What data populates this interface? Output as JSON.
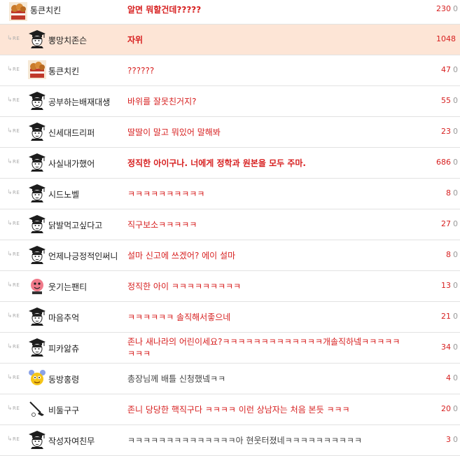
{
  "rows": [
    {
      "reply": false,
      "avatar": "fried-chicken-avatar",
      "nickname": "통큰치킨",
      "comment": "알면 뭐할건데?????",
      "style": "bold",
      "score": "230",
      "zero": "0"
    },
    {
      "reply": true,
      "avatar": "graduate-cap-avatar",
      "nickname": "뽕망치존슨",
      "comment": "자위",
      "style": "bold",
      "score": "1048",
      "zero": "",
      "highlight": true
    },
    {
      "reply": true,
      "avatar": "fried-chicken-avatar",
      "nickname": "통큰치킨",
      "comment": "??????",
      "style": "normal",
      "score": "47",
      "zero": "0"
    },
    {
      "reply": true,
      "avatar": "graduate-cap-avatar",
      "nickname": "공부하는배재대생",
      "comment": "바위를 잘못친거지?",
      "style": "normal",
      "score": "55",
      "zero": "0"
    },
    {
      "reply": true,
      "avatar": "graduate-cap-avatar",
      "nickname": "신세대드리퍼",
      "comment": "딸딸이 말고 뭐있어 말해봐",
      "style": "normal",
      "score": "23",
      "zero": "0"
    },
    {
      "reply": true,
      "avatar": "graduate-cap-avatar",
      "nickname": "사실내가했어",
      "comment": "정직한 아이구나. 너에게 정학과 원본을 모두 주마.",
      "style": "bold",
      "score": "686",
      "zero": "0"
    },
    {
      "reply": true,
      "avatar": "graduate-cap-avatar",
      "nickname": "시드노벨",
      "comment": "ㅋㅋㅋㅋㅋㅋㅋㅋㅋㅋ",
      "style": "normal",
      "score": "8",
      "zero": "0"
    },
    {
      "reply": true,
      "avatar": "graduate-cap-avatar",
      "nickname": "닭발먹고싶다고",
      "comment": "직구보소ㅋㅋㅋㅋㅋ",
      "style": "normal",
      "score": "27",
      "zero": "0"
    },
    {
      "reply": true,
      "avatar": "graduate-cap-avatar",
      "nickname": "언제나긍정적인써니",
      "comment": "설마 신고에 쓰겠어? 에이 설마",
      "style": "normal",
      "score": "8",
      "zero": "0"
    },
    {
      "reply": true,
      "avatar": "pink-face-avatar",
      "nickname": "웃기는팬티",
      "comment": "정직한 아이 ㅋㅋㅋㅋㅋㅋㅋㅋㅋ",
      "style": "normal",
      "score": "13",
      "zero": "0"
    },
    {
      "reply": true,
      "avatar": "graduate-cap-avatar",
      "nickname": "마음추억",
      "comment": "ㅋㅋㅋㅋㅋㅋ 솔직해서좋으네",
      "style": "normal",
      "score": "21",
      "zero": "0"
    },
    {
      "reply": true,
      "avatar": "graduate-cap-avatar",
      "nickname": "피카앎츄",
      "comment": "존나 새나라의 어린이세요?ㅋㅋㅋㅋㅋㅋㅋㅋㅋㅋㅋㅋㅋ개솔직하넼ㅋㅋㅋㅋㅋㅋㅋㅋ",
      "style": "normal",
      "score": "34",
      "zero": "0",
      "tall": true
    },
    {
      "reply": true,
      "avatar": "yellow-face-avatar",
      "nickname": "동방홍령",
      "comment": "총장님께 배틀 신청했넼ㅋㅋ",
      "style": "gray",
      "score": "4",
      "zero": "0"
    },
    {
      "reply": true,
      "avatar": "golf-club-avatar",
      "nickname": "비둘구구",
      "comment": "존니 당당한 핵직구다 ㅋㅋㅋㅋ 이런 상남자는 처음 본듯 ㅋㅋㅋ",
      "style": "normal",
      "score": "20",
      "zero": "0"
    },
    {
      "reply": true,
      "avatar": "graduate-cap-avatar",
      "nickname": "작성자여친무",
      "comment": "ㅋㅋㅋㅋㅋㅋㅋㅋㅋㅋㅋㅋㅋㅋ아 현웃터졌네ㅋㅋㅋㅋㅋㅋㅋㅋㅋㅋ",
      "style": "gray",
      "score": "3",
      "zero": "0"
    }
  ],
  "re_label": "RE",
  "re_arrow": "↳"
}
